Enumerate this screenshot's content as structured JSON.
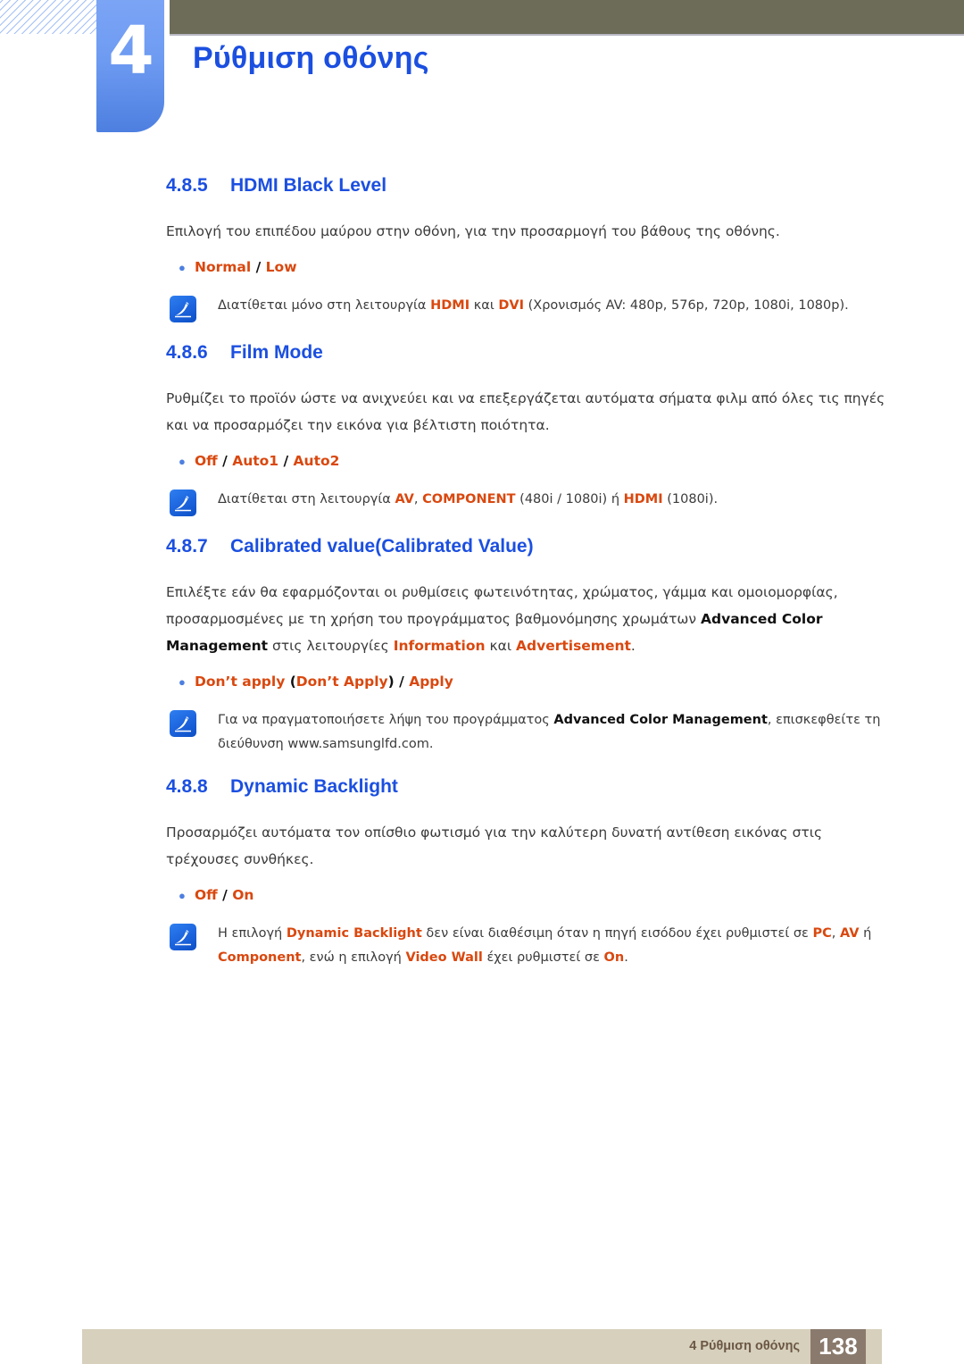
{
  "header": {
    "chapter_number": "4",
    "chapter_title": "Ρύθμιση οθόνης"
  },
  "sections": [
    {
      "number": "4.8.5",
      "title": "HDMI Black Level",
      "body": "Επιλογή του επιπέδου μαύρου στην οθόνη, για την προσαρμογή του βάθους της οθόνης.",
      "options": {
        "opt1": "Normal",
        "sep1": " / ",
        "opt2": "Low"
      },
      "note": {
        "t1": "Διατίθεται μόνο στη λειτουργία ",
        "k1": "HDMI",
        "t2": " και ",
        "k2": "DVI",
        "t3": " (Χρονισμός AV: 480p, 576p, 720p, 1080i, 1080p)."
      }
    },
    {
      "number": "4.8.6",
      "title": "Film Mode",
      "body": "Ρυθμίζει το προϊόν ώστε να ανιχνεύει και να επεξεργάζεται αυτόματα σήματα φιλμ από όλες τις πηγές και να προσαρμόζει την εικόνα για βέλτιστη ποιότητα.",
      "options": {
        "opt1": "Off",
        "sep1": " / ",
        "opt2": "Auto1",
        "sep2": " / ",
        "opt3": "Auto2"
      },
      "note": {
        "t1": "Διατίθεται στη λειτουργία ",
        "k1": "AV",
        "t2": ", ",
        "k2": "COMPONENT",
        "t3": " (480i / 1080i) ή ",
        "k3": "HDMI",
        "t4": " (1080i)."
      }
    },
    {
      "number": "4.8.7",
      "title": "Calibrated value(Calibrated Value)",
      "body_parts": {
        "p1": "Επιλέξτε εάν θα εφαρμόζονται οι ρυθμίσεις φωτεινότητας, χρώματος, γάμμα και ομοιομορφίας, προσαρμοσμένες με τη χρήση του προγράμματος βαθμονόμησης χρωμάτων ",
        "b1": "Advanced Color Management",
        "p2": " στις λειτουργίες ",
        "k1": "Information",
        "p3": " και ",
        "k2": "Advertisement",
        "p4": "."
      },
      "options": {
        "opt1": "Don’t apply",
        "sep1": " (",
        "opt2": "Don’t Apply",
        "sep2": ") / ",
        "opt3": "Apply"
      },
      "note": {
        "t1": "Για να πραγματοποιήσετε λήψη του προγράμματος ",
        "b1": "Advanced Color Management",
        "t2": ", επισκεφθείτε τη διεύθυνση www.samsunglfd.com."
      }
    },
    {
      "number": "4.8.8",
      "title": "Dynamic Backlight",
      "body": "Προσαρμόζει αυτόματα τον οπίσθιο φωτισμό για την καλύτερη δυνατή αντίθεση εικόνας στις τρέχουσες συνθήκες.",
      "options": {
        "opt1": "Off",
        "sep1": " / ",
        "opt2": "On"
      },
      "note": {
        "t1": "Η επιλογή ",
        "k1": "Dynamic Backlight",
        "t2": " δεν είναι διαθέσιμη όταν η πηγή εισόδου έχει ρυθμιστεί σε ",
        "k2": "PC",
        "t3": ", ",
        "k3": "AV",
        "t4": " ή ",
        "k4": "Component",
        "t5": ", ενώ η επιλογή ",
        "k5": "Video Wall",
        "t6": " έχει ρυθμιστεί σε ",
        "k6": "On",
        "t7": "."
      }
    }
  ],
  "footer": {
    "label": "4 Ρύθμιση οθόνης",
    "page_number": "138"
  },
  "colors": {
    "heading_blue": "#1b4fe0",
    "keyword_orange": "#d9480f",
    "olive_bar": "#6d6c58",
    "tab_blue": "#6e9bf2",
    "footer_beige": "#d6d0bc",
    "footer_box": "#8a7a6d"
  }
}
